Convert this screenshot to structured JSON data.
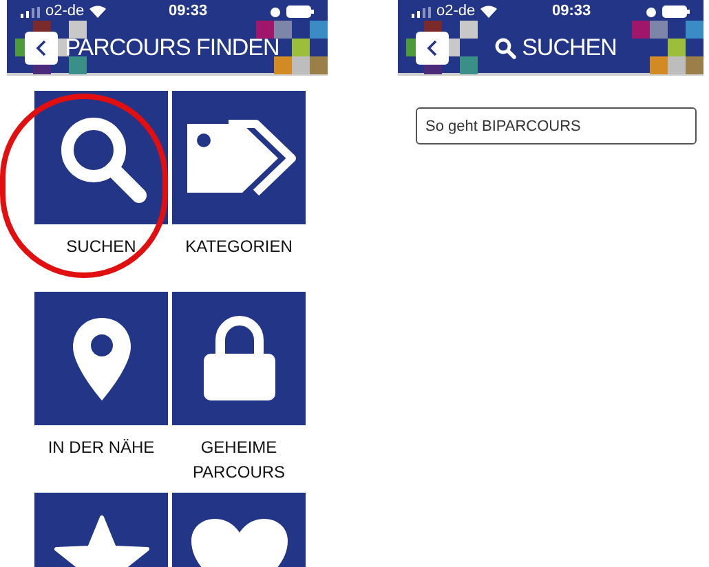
{
  "screens": [
    {
      "status_bar": {
        "carrier": "o2-de",
        "time": "09:33"
      },
      "header": {
        "title": "PARCOURS FINDEN",
        "title_icon": false
      },
      "tiles": [
        {
          "kind": "search",
          "label": "SUCHEN",
          "highlighted": true
        },
        {
          "kind": "tags",
          "label": "KATEGORIEN",
          "highlighted": false
        },
        {
          "kind": "pin",
          "label": "IN DER NÄHE",
          "highlighted": false
        },
        {
          "kind": "lock",
          "label": "GEHEIME PARCOURS",
          "highlighted": false
        },
        {
          "kind": "star",
          "highlighted": false
        },
        {
          "kind": "heart",
          "highlighted": false
        }
      ]
    },
    {
      "status_bar": {
        "carrier": "o2-de",
        "time": "09:33"
      },
      "header": {
        "title": "SUCHEN",
        "title_icon": true
      },
      "search_field": {
        "value": "So geht BIPARCOURS"
      }
    }
  ]
}
